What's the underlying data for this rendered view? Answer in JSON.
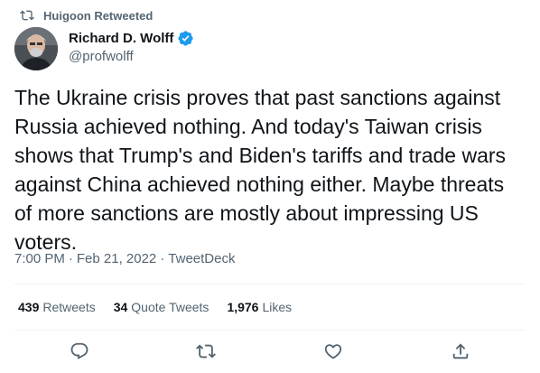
{
  "context": {
    "retweeted_by": "Huigoon Retweeted",
    "icon": "retweet-icon"
  },
  "author": {
    "display_name": "Richard D. Wolff",
    "handle": "@profwolff",
    "verified_icon": "verified-badge-icon"
  },
  "tweet": {
    "text": "The Ukraine crisis proves that past sanctions against\nRussia achieved nothing. And today's Taiwan crisis\nshows that Trump's and Biden's tariffs and trade wars\nagainst China achieved nothing either. Maybe threats\nof more sanctions are mostly about impressing US\nvoters.",
    "time": "7:00 PM",
    "separator": "·",
    "date": "Feb 21, 2022",
    "source": "TweetDeck"
  },
  "stats": [
    {
      "count": "439",
      "label": "Retweets"
    },
    {
      "count": "34",
      "label": "Quote Tweets"
    },
    {
      "count": "1,976",
      "label": "Likes"
    }
  ],
  "actions": [
    "reply-icon",
    "retweet-icon",
    "like-icon",
    "share-icon"
  ],
  "colors": {
    "text": "#0f1419",
    "secondary": "#536471",
    "verified": "#1d9bf0",
    "divider": "#eff3f4"
  }
}
